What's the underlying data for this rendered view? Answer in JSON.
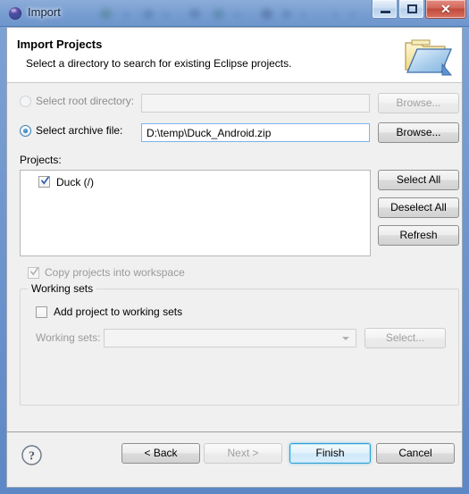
{
  "window": {
    "title": "Import",
    "icon": "eclipse-sphere-icon",
    "controls": {
      "minimize": "minimize-icon",
      "maximize": "maximize-icon",
      "close": "✕"
    }
  },
  "header": {
    "title": "Import Projects",
    "subtitle": "Select a directory to search for existing Eclipse projects.",
    "icon": "open-folder-icon"
  },
  "source": {
    "root_directory": {
      "label": "Select root directory:",
      "selected": false,
      "enabled": false,
      "value": "",
      "browse_label": "Browse..."
    },
    "archive_file": {
      "label": "Select archive file:",
      "selected": true,
      "enabled": true,
      "value": "D:\\temp\\Duck_Android.zip",
      "browse_label": "Browse..."
    }
  },
  "projects": {
    "label": "Projects:",
    "items": [
      {
        "name": "Duck (/)",
        "checked": true
      }
    ],
    "buttons": {
      "select_all": "Select All",
      "deselect_all": "Deselect All",
      "refresh": "Refresh"
    }
  },
  "options": {
    "copy_projects": {
      "label": "Copy projects into workspace",
      "checked": true,
      "enabled": false
    }
  },
  "working_sets": {
    "group_title": "Working sets",
    "add_checkbox": {
      "label": "Add project to working sets",
      "checked": false,
      "enabled": true
    },
    "combo_label": "Working sets:",
    "combo_value": "",
    "select_label": "Select..."
  },
  "footer": {
    "help": "help-icon",
    "back": "< Back",
    "next": "Next >",
    "finish": "Finish",
    "cancel": "Cancel",
    "back_enabled": true,
    "next_enabled": false,
    "finish_default": true
  },
  "colors": {
    "frame": "#6e95cd",
    "dialog_bg": "#f0f0f0",
    "header_bg": "#ffffff",
    "accent_focus": "#2c9fd6",
    "close_red": "#c04a3c"
  }
}
